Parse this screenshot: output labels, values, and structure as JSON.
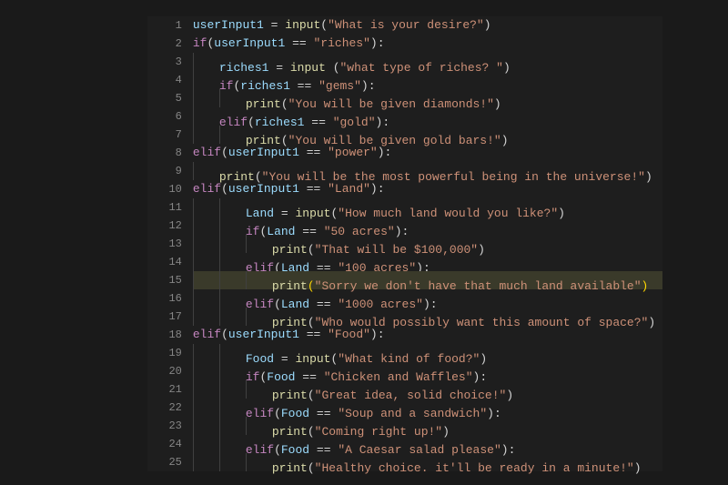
{
  "editor": {
    "highlighted_line": 15,
    "lines": [
      {
        "n": 1,
        "indent": 0,
        "segs": [
          [
            "var",
            "userInput1"
          ],
          [
            "op",
            " = "
          ],
          [
            "func",
            "input"
          ],
          [
            "paren",
            "("
          ],
          [
            "str",
            "\"What is your desire?\""
          ],
          [
            "paren",
            ")"
          ]
        ]
      },
      {
        "n": 2,
        "indent": 0,
        "segs": [
          [
            "kw",
            "if"
          ],
          [
            "paren",
            "("
          ],
          [
            "var",
            "userInput1"
          ],
          [
            "op",
            " == "
          ],
          [
            "str",
            "\"riches\""
          ],
          [
            "paren",
            ")"
          ],
          [
            "op",
            ":"
          ]
        ]
      },
      {
        "n": 3,
        "indent": 1,
        "segs": [
          [
            "var",
            "riches1"
          ],
          [
            "op",
            " = "
          ],
          [
            "func",
            "input"
          ],
          [
            "op",
            " "
          ],
          [
            "paren",
            "("
          ],
          [
            "str",
            "\"what type of riches? \""
          ],
          [
            "paren",
            ")"
          ]
        ]
      },
      {
        "n": 4,
        "indent": 1,
        "segs": [
          [
            "kw",
            "if"
          ],
          [
            "paren",
            "("
          ],
          [
            "var",
            "riches1"
          ],
          [
            "op",
            " == "
          ],
          [
            "str",
            "\"gems\""
          ],
          [
            "paren",
            ")"
          ],
          [
            "op",
            ":"
          ]
        ]
      },
      {
        "n": 5,
        "indent": 2,
        "segs": [
          [
            "func",
            "print"
          ],
          [
            "paren",
            "("
          ],
          [
            "str",
            "\"You will be given diamonds!\""
          ],
          [
            "paren",
            ")"
          ]
        ]
      },
      {
        "n": 6,
        "indent": 1,
        "segs": [
          [
            "kw",
            "elif"
          ],
          [
            "paren",
            "("
          ],
          [
            "var",
            "riches1"
          ],
          [
            "op",
            " == "
          ],
          [
            "str",
            "\"gold\""
          ],
          [
            "paren",
            ")"
          ],
          [
            "op",
            ":"
          ]
        ]
      },
      {
        "n": 7,
        "indent": 2,
        "segs": [
          [
            "func",
            "print"
          ],
          [
            "paren",
            "("
          ],
          [
            "str",
            "\"You will be given gold bars!\""
          ],
          [
            "paren",
            ")"
          ]
        ]
      },
      {
        "n": 8,
        "indent": 0,
        "segs": [
          [
            "kw",
            "elif"
          ],
          [
            "paren",
            "("
          ],
          [
            "var",
            "userInput1"
          ],
          [
            "op",
            " == "
          ],
          [
            "str",
            "\"power\""
          ],
          [
            "paren",
            ")"
          ],
          [
            "op",
            ":"
          ]
        ]
      },
      {
        "n": 9,
        "indent": 1,
        "segs": [
          [
            "func",
            "print"
          ],
          [
            "paren",
            "("
          ],
          [
            "str",
            "\"You will be the most powerful being in the universe!\""
          ],
          [
            "paren",
            ")"
          ]
        ]
      },
      {
        "n": 10,
        "indent": 0,
        "segs": [
          [
            "kw",
            "elif"
          ],
          [
            "paren",
            "("
          ],
          [
            "var",
            "userInput1"
          ],
          [
            "op",
            " == "
          ],
          [
            "str",
            "\"Land\""
          ],
          [
            "paren",
            ")"
          ],
          [
            "op",
            ":"
          ]
        ]
      },
      {
        "n": 11,
        "indent": 2,
        "segs": [
          [
            "var",
            "Land"
          ],
          [
            "op",
            " = "
          ],
          [
            "func",
            "input"
          ],
          [
            "paren",
            "("
          ],
          [
            "str",
            "\"How much land would you like?\""
          ],
          [
            "paren",
            ")"
          ]
        ]
      },
      {
        "n": 12,
        "indent": 2,
        "segs": [
          [
            "kw",
            "if"
          ],
          [
            "paren",
            "("
          ],
          [
            "var",
            "Land"
          ],
          [
            "op",
            " == "
          ],
          [
            "str",
            "\"50 acres\""
          ],
          [
            "paren",
            ")"
          ],
          [
            "op",
            ":"
          ]
        ]
      },
      {
        "n": 13,
        "indent": 3,
        "segs": [
          [
            "func",
            "print"
          ],
          [
            "paren",
            "("
          ],
          [
            "str",
            "\"That will be $100,000\""
          ],
          [
            "paren",
            ")"
          ]
        ]
      },
      {
        "n": 14,
        "indent": 2,
        "segs": [
          [
            "kw",
            "elif"
          ],
          [
            "paren",
            "("
          ],
          [
            "var",
            "Land"
          ],
          [
            "op",
            " == "
          ],
          [
            "str",
            "\"100 acres\""
          ],
          [
            "paren",
            ")"
          ],
          [
            "op",
            ":"
          ]
        ]
      },
      {
        "n": 15,
        "indent": 3,
        "segs": [
          [
            "func",
            "print"
          ],
          [
            "gold",
            "("
          ],
          [
            "str",
            "\"Sorry we don't have that much land available\""
          ],
          [
            "gold",
            ")"
          ]
        ]
      },
      {
        "n": 16,
        "indent": 2,
        "segs": [
          [
            "kw",
            "elif"
          ],
          [
            "paren",
            "("
          ],
          [
            "var",
            "Land"
          ],
          [
            "op",
            " == "
          ],
          [
            "str",
            "\"1000 acres\""
          ],
          [
            "paren",
            ")"
          ],
          [
            "op",
            ":"
          ]
        ]
      },
      {
        "n": 17,
        "indent": 3,
        "segs": [
          [
            "func",
            "print"
          ],
          [
            "paren",
            "("
          ],
          [
            "str",
            "\"Who would possibly want this amount of space?\""
          ],
          [
            "paren",
            ")"
          ]
        ]
      },
      {
        "n": 18,
        "indent": 0,
        "segs": [
          [
            "kw",
            "elif"
          ],
          [
            "paren",
            "("
          ],
          [
            "var",
            "userInput1"
          ],
          [
            "op",
            " == "
          ],
          [
            "str",
            "\"Food\""
          ],
          [
            "paren",
            ")"
          ],
          [
            "op",
            ":"
          ]
        ]
      },
      {
        "n": 19,
        "indent": 2,
        "segs": [
          [
            "var",
            "Food"
          ],
          [
            "op",
            " = "
          ],
          [
            "func",
            "input"
          ],
          [
            "paren",
            "("
          ],
          [
            "str",
            "\"What kind of food?\""
          ],
          [
            "paren",
            ")"
          ]
        ]
      },
      {
        "n": 20,
        "indent": 2,
        "segs": [
          [
            "kw",
            "if"
          ],
          [
            "paren",
            "("
          ],
          [
            "var",
            "Food"
          ],
          [
            "op",
            " == "
          ],
          [
            "str",
            "\"Chicken and Waffles\""
          ],
          [
            "paren",
            ")"
          ],
          [
            "op",
            ":"
          ]
        ]
      },
      {
        "n": 21,
        "indent": 3,
        "segs": [
          [
            "func",
            "print"
          ],
          [
            "paren",
            "("
          ],
          [
            "str",
            "\"Great idea, solid choice!\""
          ],
          [
            "paren",
            ")"
          ]
        ]
      },
      {
        "n": 22,
        "indent": 2,
        "segs": [
          [
            "kw",
            "elif"
          ],
          [
            "paren",
            "("
          ],
          [
            "var",
            "Food"
          ],
          [
            "op",
            " == "
          ],
          [
            "str",
            "\"Soup and a sandwich\""
          ],
          [
            "paren",
            ")"
          ],
          [
            "op",
            ":"
          ]
        ]
      },
      {
        "n": 23,
        "indent": 3,
        "segs": [
          [
            "func",
            "print"
          ],
          [
            "paren",
            "("
          ],
          [
            "str",
            "\"Coming right up!\""
          ],
          [
            "paren",
            ")"
          ]
        ]
      },
      {
        "n": 24,
        "indent": 2,
        "segs": [
          [
            "kw",
            "elif"
          ],
          [
            "paren",
            "("
          ],
          [
            "var",
            "Food"
          ],
          [
            "op",
            " == "
          ],
          [
            "str",
            "\"A Caesar salad please\""
          ],
          [
            "paren",
            ")"
          ],
          [
            "op",
            ":"
          ]
        ]
      },
      {
        "n": 25,
        "indent": 3,
        "segs": [
          [
            "func",
            "print"
          ],
          [
            "paren",
            "("
          ],
          [
            "str",
            "\"Healthy choice. it'll be ready in a minute!\""
          ],
          [
            "paren",
            ")"
          ]
        ]
      }
    ]
  }
}
